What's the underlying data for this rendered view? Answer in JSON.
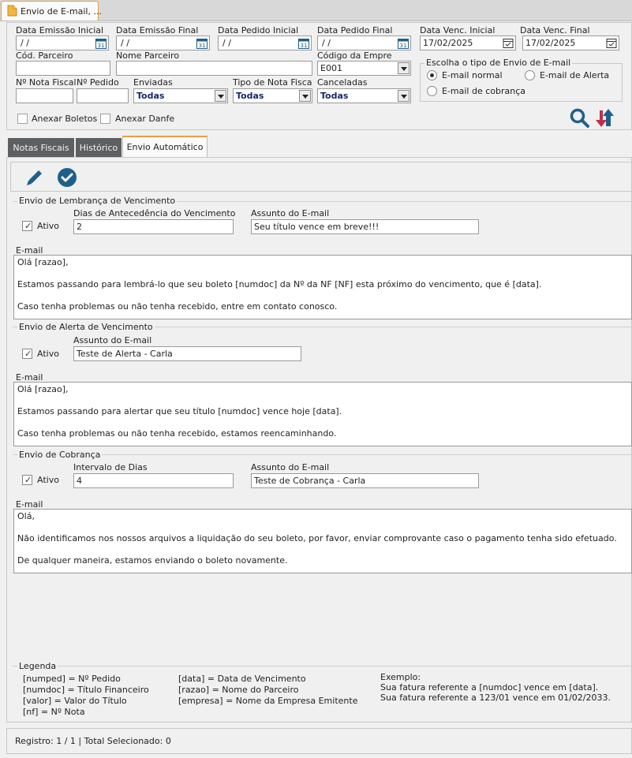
{
  "window": {
    "tab_title": "Envio de E-mail, ..."
  },
  "filters": {
    "data_emissao_inicial": {
      "label": "Data Emissão Inicial",
      "value": " /  /"
    },
    "data_emissao_final": {
      "label": "Data Emissão Final",
      "value": " /  /"
    },
    "data_pedido_inicial": {
      "label": "Data Pedido Inicial",
      "value": " /  /"
    },
    "data_pedido_final": {
      "label": "Data Pedido Final",
      "value": " /  /"
    },
    "data_venc_inicial": {
      "label": "Data Venc. Inicial",
      "value": "17/02/2025"
    },
    "data_venc_final": {
      "label": "Data Venc. Final",
      "value": "17/02/2025"
    },
    "cod_parceiro": {
      "label": "Cód. Parceiro",
      "value": ""
    },
    "nome_parceiro": {
      "label": "Nome Parceiro",
      "value": ""
    },
    "codigo_empresa": {
      "label": "Código da Empres",
      "value": "E001"
    },
    "nota_fiscal": {
      "label": "Nº Nota Fiscal",
      "value": ""
    },
    "pedido": {
      "label": "Nº Pedido",
      "value": ""
    },
    "enviadas": {
      "label": "Enviadas",
      "value": "Todas"
    },
    "tipo_nota": {
      "label": "Tipo de Nota Fisca",
      "value": "Todas"
    },
    "canceladas": {
      "label": "Canceladas",
      "value": "Todas"
    },
    "anexar_boletos": "Anexar Boletos",
    "anexar_danfe": "Anexar Danfe"
  },
  "envio_tipo": {
    "title": "Escolha o tipo de Envio de E-mail",
    "options": [
      "E-mail normal",
      "E-mail de Alerta",
      "E-mail de cobrança"
    ],
    "selected": "E-mail normal"
  },
  "tabs": [
    "Notas Fiscais",
    "Histórico",
    "Envio Automático"
  ],
  "active_tab": "Envio Automático",
  "lembranca": {
    "title": "Envio de Lembrança de Vencimento",
    "ativo_label": "Ativo",
    "dias_label": "Dias de Antecedência do Vencimento",
    "dias_value": "2",
    "assunto_label": "Assunto do E-mail",
    "assunto_value": "Seu título vence em breve!!!",
    "email_label": "E-mail",
    "email_lines": [
      "Olá [razao],",
      "",
      "Estamos passando para lembrá-lo que seu boleto [numdoc] da Nº da NF [NF] esta próximo do vencimento, que é [data].",
      "",
      "Caso tenha problemas ou não tenha recebido, entre em contato conosco."
    ]
  },
  "alerta": {
    "title": "Envio de Alerta de Vencimento",
    "ativo_label": "Ativo",
    "assunto_label": "Assunto do E-mail",
    "assunto_value": "Teste de Alerta - Carla",
    "email_label": "E-mail",
    "email_lines": [
      "Olá [razao],",
      "",
      "Estamos passando para alertar que seu título [numdoc] vence hoje [data].",
      "",
      "Caso tenha problemas ou não tenha recebido, estamos reencaminhando."
    ]
  },
  "cobranca": {
    "title": "Envio de Cobrança",
    "ativo_label": "Ativo",
    "intervalo_label": "Intervalo de Dias",
    "intervalo_value": "4",
    "assunto_label": "Assunto do E-mail",
    "assunto_value": "Teste de Cobrança - Carla",
    "email_label": "E-mail",
    "email_lines": [
      "Olá,",
      "",
      "Não identificamos nos nossos arquivos a liquidação do seu boleto, por favor, enviar comprovante caso o pagamento tenha sido efetuado.",
      "",
      "De qualquer maneira, estamos enviando o boleto novamente."
    ]
  },
  "legenda": {
    "title": "Legenda",
    "col1": [
      "[numped] = Nº Pedido",
      "[numdoc] = Título Financeiro",
      "[valor] = Valor do Título",
      "[nf] = Nº Nota"
    ],
    "col2": [
      "[data] = Data de Vencimento",
      "[razao] = Nome do Parceiro",
      "[empresa] = Nome da Empresa Emitente"
    ],
    "col3": [
      "Exemplo:",
      "Sua fatura referente a [numdoc] vence em [data].",
      "Sua fatura referente a 123/01 vence em 01/02/2033."
    ]
  },
  "status": {
    "text": "Registro: 1 / 1 | Total Selecionado: 0"
  },
  "colors": {
    "accent_orange": "#e8a040",
    "icon_blue": "#1f5f8b",
    "icon_red": "#c0304a",
    "dark_tab": "#5d6062"
  }
}
